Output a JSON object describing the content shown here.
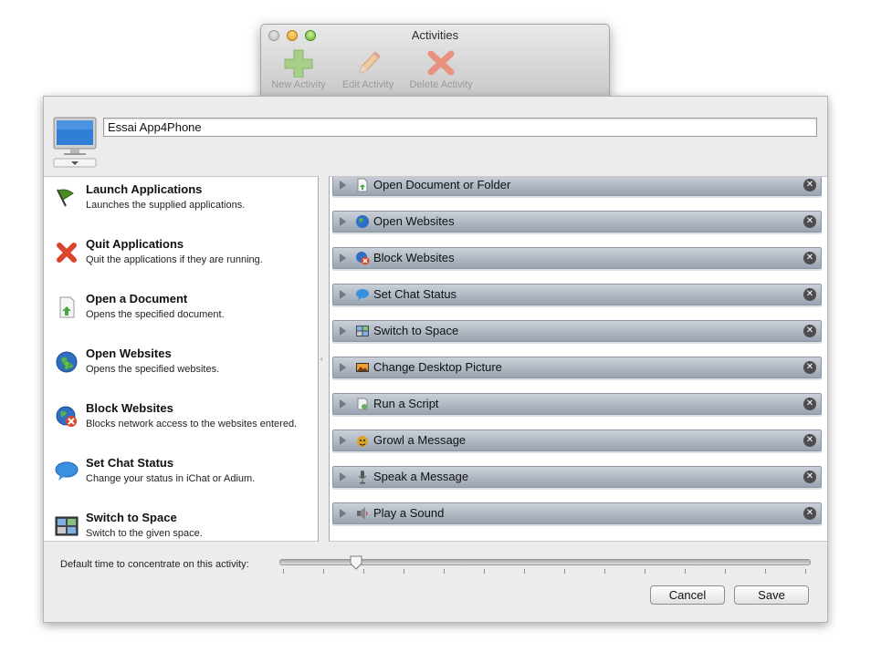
{
  "toolbar_window": {
    "title": "Activities",
    "buttons": [
      {
        "label": "New Activity",
        "icon": "plus-icon"
      },
      {
        "label": "Edit Activity",
        "icon": "pencil-icon"
      },
      {
        "label": "Delete Activity",
        "icon": "delete-x-icon"
      }
    ]
  },
  "activity": {
    "name": "Essai App4Phone"
  },
  "library": [
    {
      "title": "Launch Applications",
      "desc": "Launches the supplied applications.",
      "icon": "flag-icon"
    },
    {
      "title": "Quit Applications",
      "desc": "Quit the applications if they are running.",
      "icon": "red-x-icon"
    },
    {
      "title": "Open a Document",
      "desc": "Opens the specified document.",
      "icon": "document-icon"
    },
    {
      "title": "Open Websites",
      "desc": "Opens the specified websites.",
      "icon": "globe-icon"
    },
    {
      "title": "Block Websites",
      "desc": "Blocks network access to the websites entered.",
      "icon": "blocked-globe-icon"
    },
    {
      "title": "Set Chat Status",
      "desc": "Change your status in iChat or Adium.",
      "icon": "chat-bubble-icon"
    },
    {
      "title": "Switch to Space",
      "desc": "Switch to the given space.",
      "icon": "spaces-icon"
    }
  ],
  "actions": [
    {
      "label": "Open Document or Folder",
      "icon": "document-icon"
    },
    {
      "label": "Open Websites",
      "icon": "globe-icon"
    },
    {
      "label": "Block Websites",
      "icon": "blocked-globe-icon"
    },
    {
      "label": "Set Chat Status",
      "icon": "chat-bubble-icon"
    },
    {
      "label": "Switch to Space",
      "icon": "spaces-icon"
    },
    {
      "label": "Change Desktop Picture",
      "icon": "picture-icon"
    },
    {
      "label": "Run a Script",
      "icon": "script-icon"
    },
    {
      "label": "Growl a Message",
      "icon": "growl-icon"
    },
    {
      "label": "Speak a Message",
      "icon": "microphone-icon"
    },
    {
      "label": "Play a Sound",
      "icon": "speaker-icon"
    }
  ],
  "footer": {
    "slider_label": "Default time to concentrate on this activity:",
    "slider_value": 0.14,
    "cancel_label": "Cancel",
    "save_label": "Save"
  },
  "colors": {
    "action_bar": "#9aa5b2",
    "window_bg": "#ececec"
  }
}
